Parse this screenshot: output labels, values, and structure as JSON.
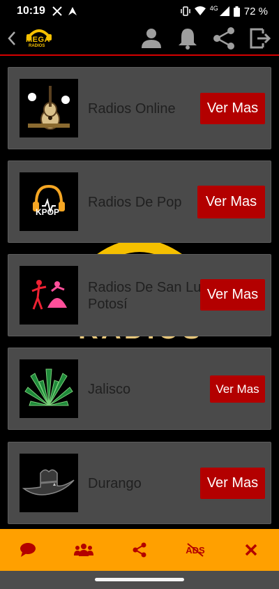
{
  "status": {
    "time": "10:19",
    "network": "4G",
    "battery": "72 %"
  },
  "app": {
    "logo_top": "MEGA",
    "logo_bottom": "RADIOS",
    "actions": [
      "user-icon",
      "bell-icon",
      "share-icon",
      "exit-icon"
    ]
  },
  "background_text": "RADIOS",
  "cards": [
    {
      "title": "Radios Online",
      "button": "Ver Mas",
      "image": "guitar-music-icon"
    },
    {
      "title": "Radios De Pop",
      "button": "Ver Mas",
      "image": "kpop-headphones-icon",
      "image_label": "KPOP"
    },
    {
      "title": "Radios De San Luis Potosí",
      "button": "Ver Mas",
      "image": "dancers-icon"
    },
    {
      "title": "Jalisco",
      "button": "Ver Mas",
      "image": "agave-icon"
    },
    {
      "title": "Durango",
      "button": "Ver Mas",
      "image": "cowboy-hat-icon"
    }
  ],
  "bottom_bar": [
    "chat-icon",
    "group-icon",
    "share-icon",
    "no-ads-icon",
    "close-icon"
  ],
  "bottom_bar_no_ads_label": "ADS",
  "colors": {
    "accent": "#b30000",
    "bar": "#ffa000",
    "card": "#4a4a4a"
  }
}
